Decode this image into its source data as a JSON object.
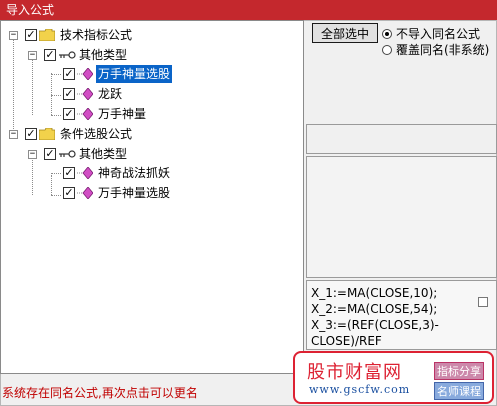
{
  "window": {
    "title": "导入公式"
  },
  "tree": {
    "root1": {
      "label": "技术指标公式"
    },
    "root1_child": {
      "label": "其他类型"
    },
    "root1_items": [
      "万手神量选股",
      "龙跃",
      "万手神量"
    ],
    "root2": {
      "label": "条件选股公式"
    },
    "root2_child": {
      "label": "其他类型"
    },
    "root2_items": [
      "神奇战法抓妖",
      "万手神量选股"
    ],
    "toggle_symbol": "−",
    "check_symbol": "✓"
  },
  "right": {
    "select_all_label": "全部选中",
    "radio1_label": "不导入同名公式",
    "radio2_label": "覆盖同名(非系统)"
  },
  "code": {
    "lines": [
      "X_1:=MA(CLOSE,10);",
      "X_2:=MA(CLOSE,54);",
      "X_3:=(REF(CLOSE,3)-",
      "CLOSE)/REF"
    ]
  },
  "status": {
    "message": "系统存在同名公式,再次点击可以更名"
  },
  "watermark": {
    "title": "股市财富网",
    "url": "www.gscfw.com",
    "tag1": "指标分享",
    "tag2": "名师课程"
  },
  "colors": {
    "title_bar": "#c4282d",
    "selection": "#0a64c8",
    "status_text": "#c00000"
  }
}
